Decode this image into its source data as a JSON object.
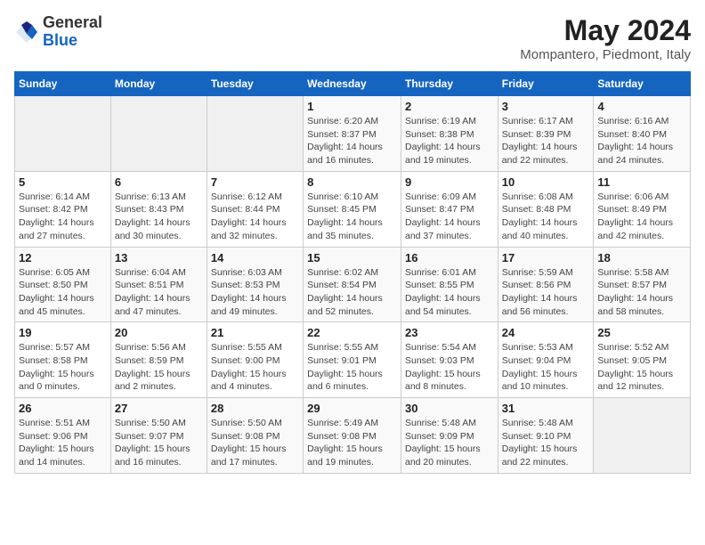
{
  "header": {
    "logo_general": "General",
    "logo_blue": "Blue",
    "month_year": "May 2024",
    "location": "Mompantero, Piedmont, Italy"
  },
  "days_of_week": [
    "Sunday",
    "Monday",
    "Tuesday",
    "Wednesday",
    "Thursday",
    "Friday",
    "Saturday"
  ],
  "weeks": [
    [
      {
        "day": "",
        "info": ""
      },
      {
        "day": "",
        "info": ""
      },
      {
        "day": "",
        "info": ""
      },
      {
        "day": "1",
        "info": "Sunrise: 6:20 AM\nSunset: 8:37 PM\nDaylight: 14 hours\nand 16 minutes."
      },
      {
        "day": "2",
        "info": "Sunrise: 6:19 AM\nSunset: 8:38 PM\nDaylight: 14 hours\nand 19 minutes."
      },
      {
        "day": "3",
        "info": "Sunrise: 6:17 AM\nSunset: 8:39 PM\nDaylight: 14 hours\nand 22 minutes."
      },
      {
        "day": "4",
        "info": "Sunrise: 6:16 AM\nSunset: 8:40 PM\nDaylight: 14 hours\nand 24 minutes."
      }
    ],
    [
      {
        "day": "5",
        "info": "Sunrise: 6:14 AM\nSunset: 8:42 PM\nDaylight: 14 hours\nand 27 minutes."
      },
      {
        "day": "6",
        "info": "Sunrise: 6:13 AM\nSunset: 8:43 PM\nDaylight: 14 hours\nand 30 minutes."
      },
      {
        "day": "7",
        "info": "Sunrise: 6:12 AM\nSunset: 8:44 PM\nDaylight: 14 hours\nand 32 minutes."
      },
      {
        "day": "8",
        "info": "Sunrise: 6:10 AM\nSunset: 8:45 PM\nDaylight: 14 hours\nand 35 minutes."
      },
      {
        "day": "9",
        "info": "Sunrise: 6:09 AM\nSunset: 8:47 PM\nDaylight: 14 hours\nand 37 minutes."
      },
      {
        "day": "10",
        "info": "Sunrise: 6:08 AM\nSunset: 8:48 PM\nDaylight: 14 hours\nand 40 minutes."
      },
      {
        "day": "11",
        "info": "Sunrise: 6:06 AM\nSunset: 8:49 PM\nDaylight: 14 hours\nand 42 minutes."
      }
    ],
    [
      {
        "day": "12",
        "info": "Sunrise: 6:05 AM\nSunset: 8:50 PM\nDaylight: 14 hours\nand 45 minutes."
      },
      {
        "day": "13",
        "info": "Sunrise: 6:04 AM\nSunset: 8:51 PM\nDaylight: 14 hours\nand 47 minutes."
      },
      {
        "day": "14",
        "info": "Sunrise: 6:03 AM\nSunset: 8:53 PM\nDaylight: 14 hours\nand 49 minutes."
      },
      {
        "day": "15",
        "info": "Sunrise: 6:02 AM\nSunset: 8:54 PM\nDaylight: 14 hours\nand 52 minutes."
      },
      {
        "day": "16",
        "info": "Sunrise: 6:01 AM\nSunset: 8:55 PM\nDaylight: 14 hours\nand 54 minutes."
      },
      {
        "day": "17",
        "info": "Sunrise: 5:59 AM\nSunset: 8:56 PM\nDaylight: 14 hours\nand 56 minutes."
      },
      {
        "day": "18",
        "info": "Sunrise: 5:58 AM\nSunset: 8:57 PM\nDaylight: 14 hours\nand 58 minutes."
      }
    ],
    [
      {
        "day": "19",
        "info": "Sunrise: 5:57 AM\nSunset: 8:58 PM\nDaylight: 15 hours\nand 0 minutes."
      },
      {
        "day": "20",
        "info": "Sunrise: 5:56 AM\nSunset: 8:59 PM\nDaylight: 15 hours\nand 2 minutes."
      },
      {
        "day": "21",
        "info": "Sunrise: 5:55 AM\nSunset: 9:00 PM\nDaylight: 15 hours\nand 4 minutes."
      },
      {
        "day": "22",
        "info": "Sunrise: 5:55 AM\nSunset: 9:01 PM\nDaylight: 15 hours\nand 6 minutes."
      },
      {
        "day": "23",
        "info": "Sunrise: 5:54 AM\nSunset: 9:03 PM\nDaylight: 15 hours\nand 8 minutes."
      },
      {
        "day": "24",
        "info": "Sunrise: 5:53 AM\nSunset: 9:04 PM\nDaylight: 15 hours\nand 10 minutes."
      },
      {
        "day": "25",
        "info": "Sunrise: 5:52 AM\nSunset: 9:05 PM\nDaylight: 15 hours\nand 12 minutes."
      }
    ],
    [
      {
        "day": "26",
        "info": "Sunrise: 5:51 AM\nSunset: 9:06 PM\nDaylight: 15 hours\nand 14 minutes."
      },
      {
        "day": "27",
        "info": "Sunrise: 5:50 AM\nSunset: 9:07 PM\nDaylight: 15 hours\nand 16 minutes."
      },
      {
        "day": "28",
        "info": "Sunrise: 5:50 AM\nSunset: 9:08 PM\nDaylight: 15 hours\nand 17 minutes."
      },
      {
        "day": "29",
        "info": "Sunrise: 5:49 AM\nSunset: 9:08 PM\nDaylight: 15 hours\nand 19 minutes."
      },
      {
        "day": "30",
        "info": "Sunrise: 5:48 AM\nSunset: 9:09 PM\nDaylight: 15 hours\nand 20 minutes."
      },
      {
        "day": "31",
        "info": "Sunrise: 5:48 AM\nSunset: 9:10 PM\nDaylight: 15 hours\nand 22 minutes."
      },
      {
        "day": "",
        "info": ""
      }
    ]
  ]
}
